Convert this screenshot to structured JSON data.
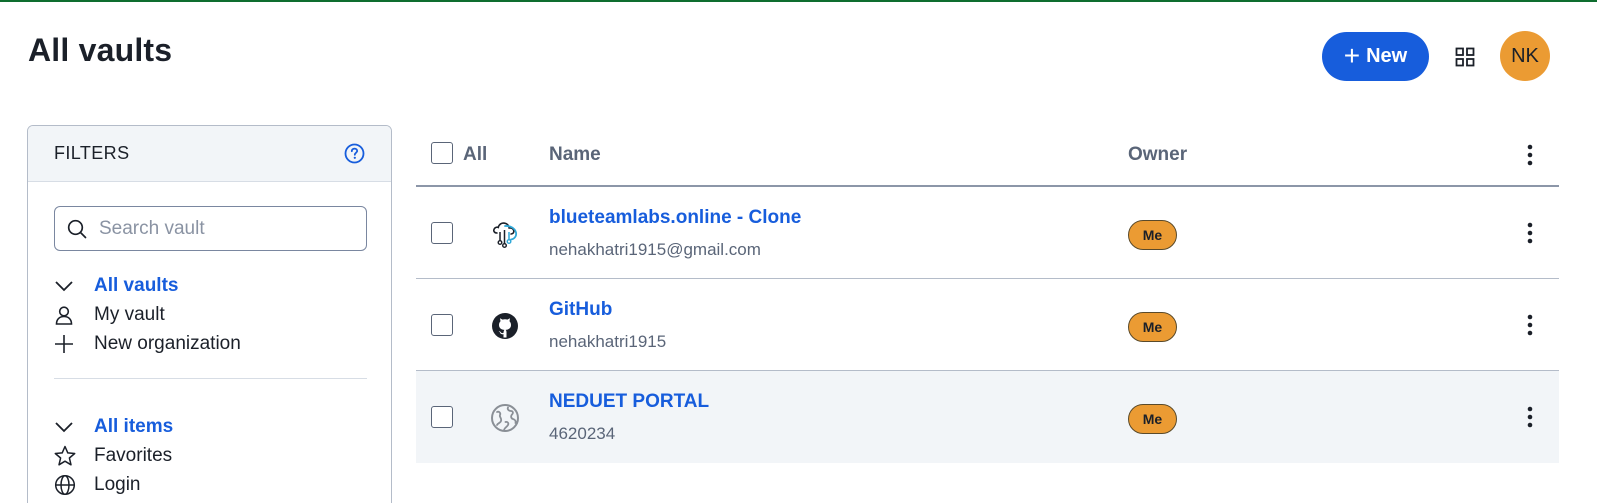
{
  "header": {
    "title": "All vaults",
    "new_label": "New",
    "avatar_initials": "NK",
    "accent_color": "#175ddc",
    "avatar_color": "#eb9b33"
  },
  "filters": {
    "title": "FILTERS",
    "search_placeholder": "Search vault",
    "vault_group": {
      "label": "All vaults",
      "items": [
        {
          "label": "My vault",
          "icon": "user-icon"
        },
        {
          "label": "New organization",
          "icon": "plus-icon"
        }
      ]
    },
    "items_group": {
      "label": "All items",
      "items": [
        {
          "label": "Favorites",
          "icon": "star-icon"
        },
        {
          "label": "Login",
          "icon": "globe-icon"
        }
      ]
    }
  },
  "table": {
    "columns": {
      "all": "All",
      "name": "Name",
      "owner": "Owner"
    },
    "rows": [
      {
        "name": "blueteamlabs.online - Clone",
        "subtitle": "nehakhatri1915@gmail.com",
        "owner": "Me",
        "icon": "site-favicon-icon"
      },
      {
        "name": "GitHub",
        "subtitle": "nehakhatri1915",
        "owner": "Me",
        "icon": "github-icon"
      },
      {
        "name": "NEDUET PORTAL",
        "subtitle": "4620234",
        "owner": "Me",
        "icon": "globe-icon"
      }
    ]
  }
}
